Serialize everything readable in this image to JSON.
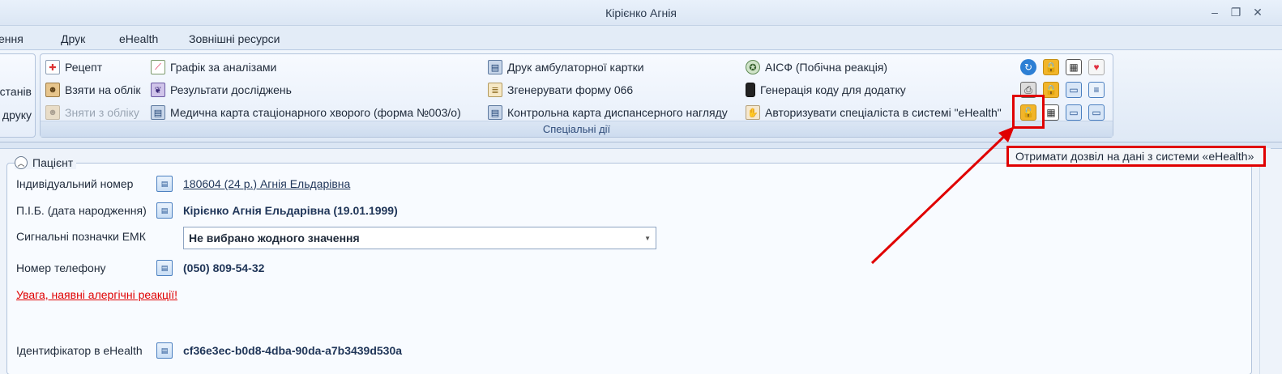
{
  "window": {
    "title": "Кірієнко Агнія"
  },
  "menu": [
    "ення",
    "Друк",
    "eHealth",
    "Зовнішні ресурси"
  ],
  "ribbon_left": [
    "станів",
    "друку"
  ],
  "ribbon": {
    "col1": [
      {
        "label": "Рецепт",
        "icon": "prescription-icon",
        "enabled": true
      },
      {
        "label": "Взяти на облік",
        "icon": "register-person-icon",
        "enabled": true
      },
      {
        "label": "Зняти з обліку",
        "icon": "unregister-person-icon",
        "enabled": false
      }
    ],
    "col2": [
      {
        "label": "Графік за аналізами",
        "icon": "graph-icon"
      },
      {
        "label": "Результати досліджень",
        "icon": "lungs-icon"
      },
      {
        "label": "Медична карта стаціонарного хворого (форма №003/о)",
        "icon": "print-card-icon"
      }
    ],
    "col3": [
      {
        "label": "Друк амбулаторної картки",
        "icon": "print-icon"
      },
      {
        "label": "Згенерувати форму 066",
        "icon": "form-icon"
      },
      {
        "label": "Контрольна карта диспансерного нагляду",
        "icon": "print-card-icon"
      }
    ],
    "col4": [
      {
        "label": "АІСФ (Побічна реакція)",
        "icon": "seal-icon"
      },
      {
        "label": "Генерація коду для додатку",
        "icon": "phone-icon"
      },
      {
        "label": "Авторизувати спеціаліста в системі \"eHealth\"",
        "icon": "hand-icon"
      }
    ],
    "group_caption": "Спеціальні дії"
  },
  "tooltip": "Отримати дозвіл на дані з системи «eHealth»",
  "patient": {
    "section_title": "Пацієнт",
    "fields": {
      "individual_number": {
        "label": "Індивідуальний номер",
        "value": "180604 (24 р.) Агнія Ельдарівна"
      },
      "full_name": {
        "label": "П.І.Б. (дата народження)",
        "value": "Кірієнко Агнія Ельдарівна (19.01.1999)"
      },
      "signal_marks": {
        "label": "Сигнальні позначки ЕМК",
        "value": "Не вибрано жодного значення"
      },
      "phone": {
        "label": "Номер телефону",
        "value": "(050) 809-54-32"
      },
      "allergy_warning": "Увага, наявні алергічні реакції!",
      "ehealth_id": {
        "label": "Ідентифікатор в eHealth",
        "value": "cf36e3ec-b0d8-4dba-90da-a7b3439d530a"
      }
    }
  },
  "colors": {
    "highlight": "#e00000",
    "link": "#1f3558",
    "warning": "#e00000"
  }
}
